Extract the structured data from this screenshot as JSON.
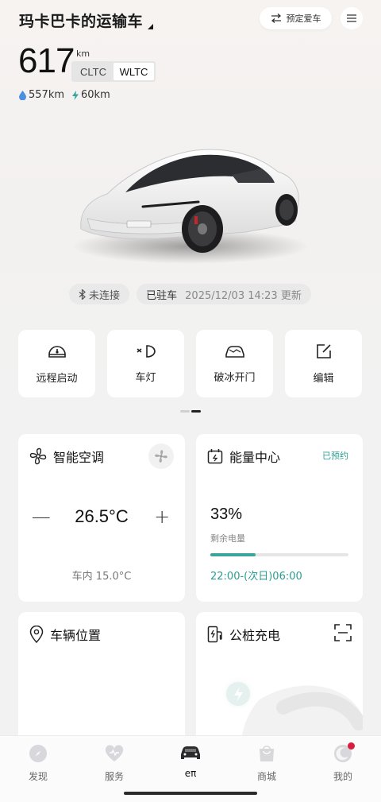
{
  "header": {
    "vehicle_name": "玛卡巴卡的运输车",
    "reserve_label": "预定爱车"
  },
  "range": {
    "value": "617",
    "unit": "km",
    "standards": [
      "CLTC",
      "WLTC"
    ],
    "active_standard": "WLTC",
    "fuel_range": "557km",
    "electric_range": "60km"
  },
  "status": {
    "bluetooth": "未连接",
    "parked": "已驻车",
    "timestamp": "2025/12/03 14:23",
    "updated": "更新"
  },
  "quick_actions": [
    {
      "label": "远程启动",
      "icon": "remote-start-icon"
    },
    {
      "label": "车灯",
      "icon": "headlight-icon"
    },
    {
      "label": "破冰开门",
      "icon": "ice-break-door-icon"
    },
    {
      "label": "编辑",
      "icon": "edit-icon"
    }
  ],
  "pager": {
    "pages": 2,
    "active": 1
  },
  "ac_card": {
    "title": "智能空调",
    "temperature": "26.5°C",
    "minus": "—",
    "plus": "+",
    "inside": "车内 15.0°C"
  },
  "energy_card": {
    "title": "能量中心",
    "badge": "已预约",
    "percent": "33%",
    "label": "剩余电量",
    "level": 0.33,
    "schedule": "22:00-(次日)06:00"
  },
  "location_card": {
    "title": "车辆位置"
  },
  "charger_card": {
    "title": "公桩充电"
  },
  "bottom_nav": [
    {
      "label": "发现",
      "icon": "discover-icon"
    },
    {
      "label": "服务",
      "icon": "service-icon"
    },
    {
      "label": "eπ",
      "icon": "car-icon"
    },
    {
      "label": "商城",
      "icon": "shop-icon"
    },
    {
      "label": "我的",
      "icon": "profile-icon"
    }
  ],
  "colors": {
    "accent": "#2a9d8f",
    "badge_dot": "#d81e3c"
  }
}
